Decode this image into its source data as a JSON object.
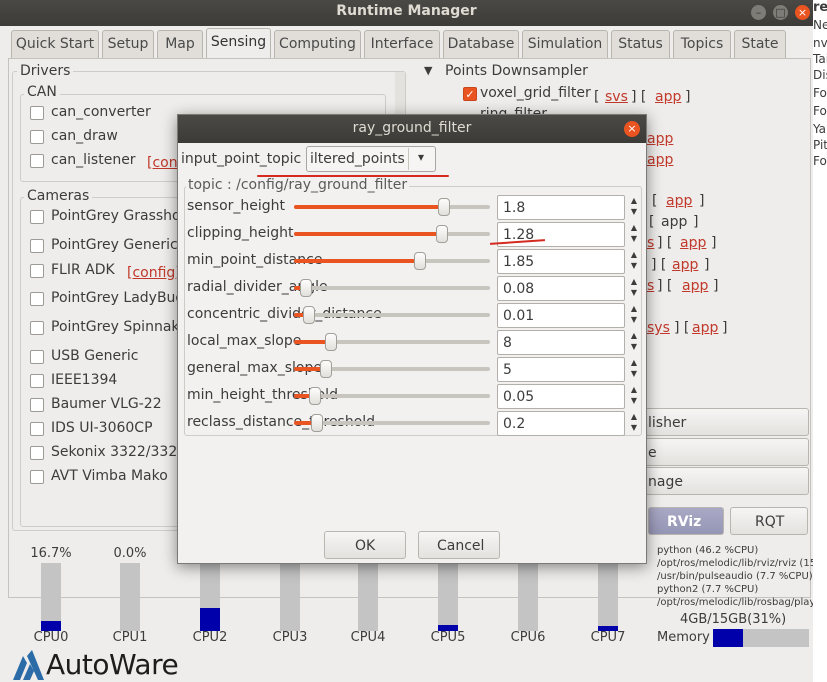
{
  "window": {
    "title": "Runtime Manager",
    "tabs": [
      "Quick Start",
      "Setup",
      "Map",
      "Sensing",
      "Computing",
      "Interface",
      "Database",
      "Simulation",
      "Status",
      "Topics",
      "State"
    ],
    "active_tab": "Sensing",
    "controls": {
      "minimize": "–",
      "maximize": "□",
      "close": "×"
    }
  },
  "drivers": {
    "title": "Drivers",
    "can": {
      "title": "CAN",
      "items": [
        "can_converter",
        "can_draw",
        "can_listener"
      ],
      "config": "[con"
    },
    "cameras": {
      "title": "Cameras",
      "items": [
        "PointGrey Grasshopp",
        "PointGrey Generic",
        "FLIR ADK",
        "PointGrey LadyBug",
        "PointGrey Spinnaker",
        "USB Generic",
        "IEEE1394",
        "Baumer VLG-22",
        "IDS UI-3060CP",
        "Sekonix 3322/3323",
        "AVT Vimba Mako"
      ],
      "config": "[config]"
    }
  },
  "points": {
    "header": "Points Downsampler",
    "row1": {
      "label": "voxel_grid_filter",
      "svs": "svs",
      "app": "app",
      "open": "[",
      "mid": "] [",
      "close": "]"
    },
    "row2_partial": "ring_filter",
    "links": [
      "app",
      "app",
      "app",
      "app",
      "s",
      "app",
      "app",
      "s",
      "app",
      "sys",
      "app"
    ],
    "br_open": "[",
    "br_close": "]",
    "br_sep": "] [",
    "buttons": [
      "lisher",
      "e",
      "nage"
    ]
  },
  "action_buttons": {
    "rviz": "RViz",
    "rqt": "RQT"
  },
  "cpu": {
    "cpus": [
      {
        "label": "CPU0",
        "pct": "16.7%",
        "fill": 0.14
      },
      {
        "label": "CPU1",
        "pct": "0.0%",
        "fill": 0.0
      },
      {
        "label": "CPU2",
        "pct": "",
        "fill": 0.34
      },
      {
        "label": "CPU3",
        "pct": "",
        "fill": 0.0
      },
      {
        "label": "CPU4",
        "pct": "",
        "fill": 0.0
      },
      {
        "label": "CPU5",
        "pct": "",
        "fill": 0.09
      },
      {
        "label": "CPU6",
        "pct": "",
        "fill": 0.0
      },
      {
        "label": "CPU7",
        "pct": "",
        "fill": 0.07
      }
    ],
    "processes": [
      "python (46.2 %CPU)",
      "/opt/ros/melodic/lib/rviz/rviz (15.",
      "/usr/bin/pulseaudio (7.7 %CPU)",
      "python2 (7.7 %CPU)",
      "/opt/ros/melodic/lib/rosbag/play"
    ],
    "memory": {
      "label": "Memory",
      "usage": "4GB/15GB(31%)",
      "fill": 0.31
    }
  },
  "logo": {
    "text": "AutoWare"
  },
  "right_strip": {
    "lines": [
      "re",
      "Ne",
      "nv",
      "Tai",
      "Dis",
      "Fo",
      "Fo",
      "Ya",
      "Pit",
      "Fo"
    ]
  },
  "dialog": {
    "title": "ray_ground_filter",
    "close": "×",
    "input_label": "input_point_topic",
    "input_value": "iltered_points",
    "combo_arrow": "▾",
    "topic_title": "topic : /config/ray_ground_filter",
    "params": [
      {
        "name": "sensor_height",
        "value": "1.8",
        "pos": 0.78
      },
      {
        "name": "clipping_height",
        "value": "1.28",
        "pos": 0.77
      },
      {
        "name": "min_point_distance",
        "value": "1.85",
        "pos": 0.65
      },
      {
        "name": "radial_divider_angle",
        "value": "0.08",
        "pos": 0.03
      },
      {
        "name": "concentric_divider_distance",
        "value": "0.01",
        "pos": 0.05
      },
      {
        "name": "local_max_slope",
        "value": "8",
        "pos": 0.17
      },
      {
        "name": "general_max_slope",
        "value": "5",
        "pos": 0.14
      },
      {
        "name": "min_height_threshold",
        "value": "0.05",
        "pos": 0.08
      },
      {
        "name": "reclass_distance_threshold",
        "value": "0.2",
        "pos": 0.09
      }
    ],
    "spin_up": "▲",
    "spin_down": "▼",
    "ok": "OK",
    "cancel": "Cancel"
  },
  "colors": {
    "accent": "#e95420",
    "cpu_fill": "#0000aa",
    "link": "#c0392b",
    "annotation": "#d42a1f"
  }
}
